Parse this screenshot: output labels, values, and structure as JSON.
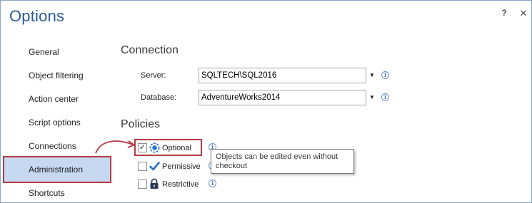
{
  "window": {
    "title": "Options",
    "help_label": "?",
    "close_label": "✕"
  },
  "nav": {
    "items": [
      {
        "label": "General"
      },
      {
        "label": "Object filtering"
      },
      {
        "label": "Action center"
      },
      {
        "label": "Script options"
      },
      {
        "label": "Connections"
      },
      {
        "label": "Administration",
        "selected": true
      },
      {
        "label": "Shortcuts"
      }
    ]
  },
  "connection": {
    "heading": "Connection",
    "server_label": "Server:",
    "server_value": "SQLTECH\\SQL2016",
    "database_label": "Database:",
    "database_value": "AdventureWorks2014"
  },
  "policies": {
    "heading": "Policies",
    "items": [
      {
        "label": "Optional",
        "checked": true
      },
      {
        "label": "Permissive",
        "checked": false
      },
      {
        "label": "Restrictive",
        "checked": false
      }
    ],
    "tooltip": "Objects can be edited even without checkout"
  },
  "colors": {
    "title": "#2b5b94",
    "selection_bg": "#c7d9f1",
    "highlight_border": "#b63b43",
    "icon_blue": "#1f6fc6"
  },
  "icons": [
    "help-icon",
    "close-icon",
    "dropdown-arrow-icon",
    "info-icon",
    "optional-policy-icon",
    "permissive-checkmark-icon",
    "lock-icon",
    "curved-arrow-icon"
  ]
}
